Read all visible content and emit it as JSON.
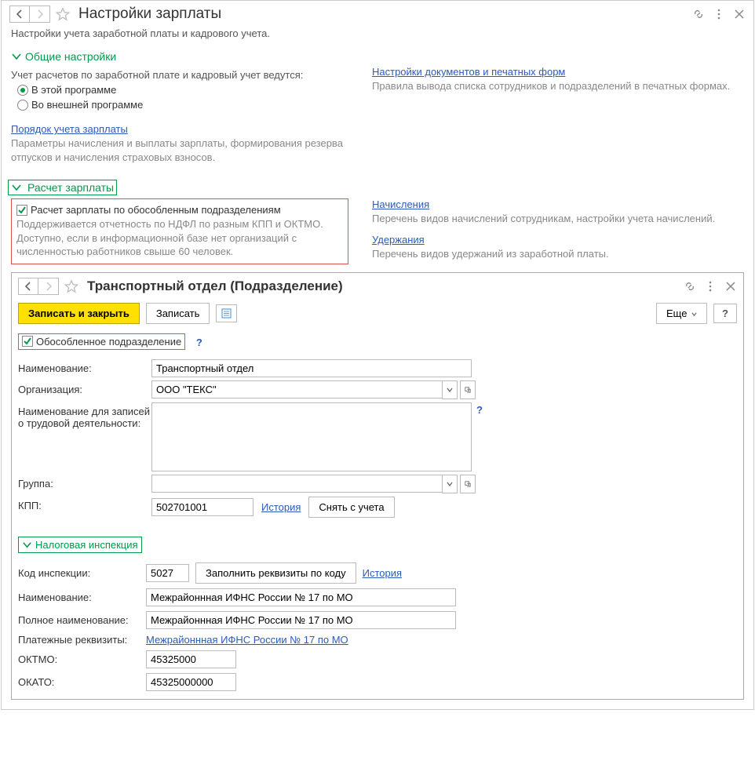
{
  "window1": {
    "title": "Настройки зарплаты",
    "subtitle": "Настройки учета заработной платы и кадрового учета.",
    "section1": {
      "title": "Общие настройки",
      "lead": "Учет расчетов по заработной плате и кадровый учет ведутся:",
      "radio1": "В этой программе",
      "radio2": "Во внешней программе",
      "link1": "Порядок учета зарплаты",
      "desc1": "Параметры начисления и выплаты зарплаты, формирования резерва отпусков и начисления страховых взносов.",
      "linkR": "Настройки документов и печатных форм",
      "descR": "Правила вывода списка сотрудников и подразделений в печатных формах."
    },
    "section2": {
      "title": "Расчет зарплаты",
      "chk": "Расчет зарплаты по обособленным подразделениям",
      "desc": "Поддерживается отчетность по НДФЛ по разным КПП и ОКТМО. Доступно, если в информационной базе нет организаций с численностью работников свыше 60 человек.",
      "linkR1": "Начисления",
      "descR1": "Перечень видов начислений сотрудникам, настройки учета начислений.",
      "linkR2": "Удержания",
      "descR2": "Перечень видов удержаний из заработной платы."
    }
  },
  "window2": {
    "title": "Транспортный отдел (Подразделение)",
    "saveClose": "Записать и закрыть",
    "save": "Записать",
    "more": "Еще",
    "help": "?",
    "chk": "Обособленное подразделение",
    "fields": {
      "name_lbl": "Наименование:",
      "name_val": "Транспортный отдел",
      "org_lbl": "Организация:",
      "org_val": "ООО \"ТЕКС\"",
      "labor_lbl": "Наименование для записей о трудовой деятельности:",
      "labor_val": "",
      "group_lbl": "Группа:",
      "group_val": "",
      "kpp_lbl": "КПП:",
      "kpp_val": "502701001",
      "history": "История",
      "deregister": "Снять с учета"
    },
    "taxsect": "Налоговая инспекция",
    "tax": {
      "code_lbl": "Код инспекции:",
      "code_val": "5027",
      "fill_btn": "Заполнить реквизиты по коду",
      "history": "История",
      "name_lbl": "Наименование:",
      "name_val": "Межрайоннная ИФНС России № 17 по МО",
      "full_lbl": "Полное наименование:",
      "full_val": "Межрайоннная ИФНС России № 17 по МО",
      "pay_lbl": "Платежные реквизиты:",
      "pay_link": "Межрайоннная ИФНС России № 17 по МО",
      "oktmo_lbl": "ОКТМО:",
      "oktmo_val": "45325000",
      "okato_lbl": "ОКАТО:",
      "okato_val": "45325000000"
    }
  }
}
